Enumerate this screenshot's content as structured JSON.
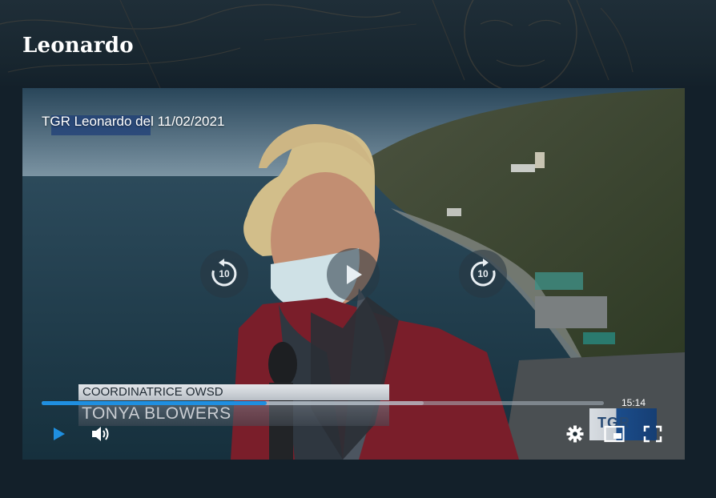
{
  "page": {
    "title": "Leonardo"
  },
  "player": {
    "video_title": "TGR Leonardo del 11/02/2021",
    "caption_role": "COORDINATRICE OWSD",
    "caption_name": "TONYA BLOWERS",
    "channel_bug": "TGR",
    "rewind_label": "10",
    "forward_label": "10",
    "duration": "15:14",
    "progress": 0.4,
    "buffered": 0.68,
    "accent": "#1f8fe0",
    "icons": {
      "play": "play-icon",
      "volume": "volume-icon",
      "settings": "gear-icon",
      "pip": "picture-in-picture-icon",
      "fullscreen": "fullscreen-icon",
      "rewind": "rewind-10-icon",
      "forward": "forward-10-icon"
    }
  }
}
